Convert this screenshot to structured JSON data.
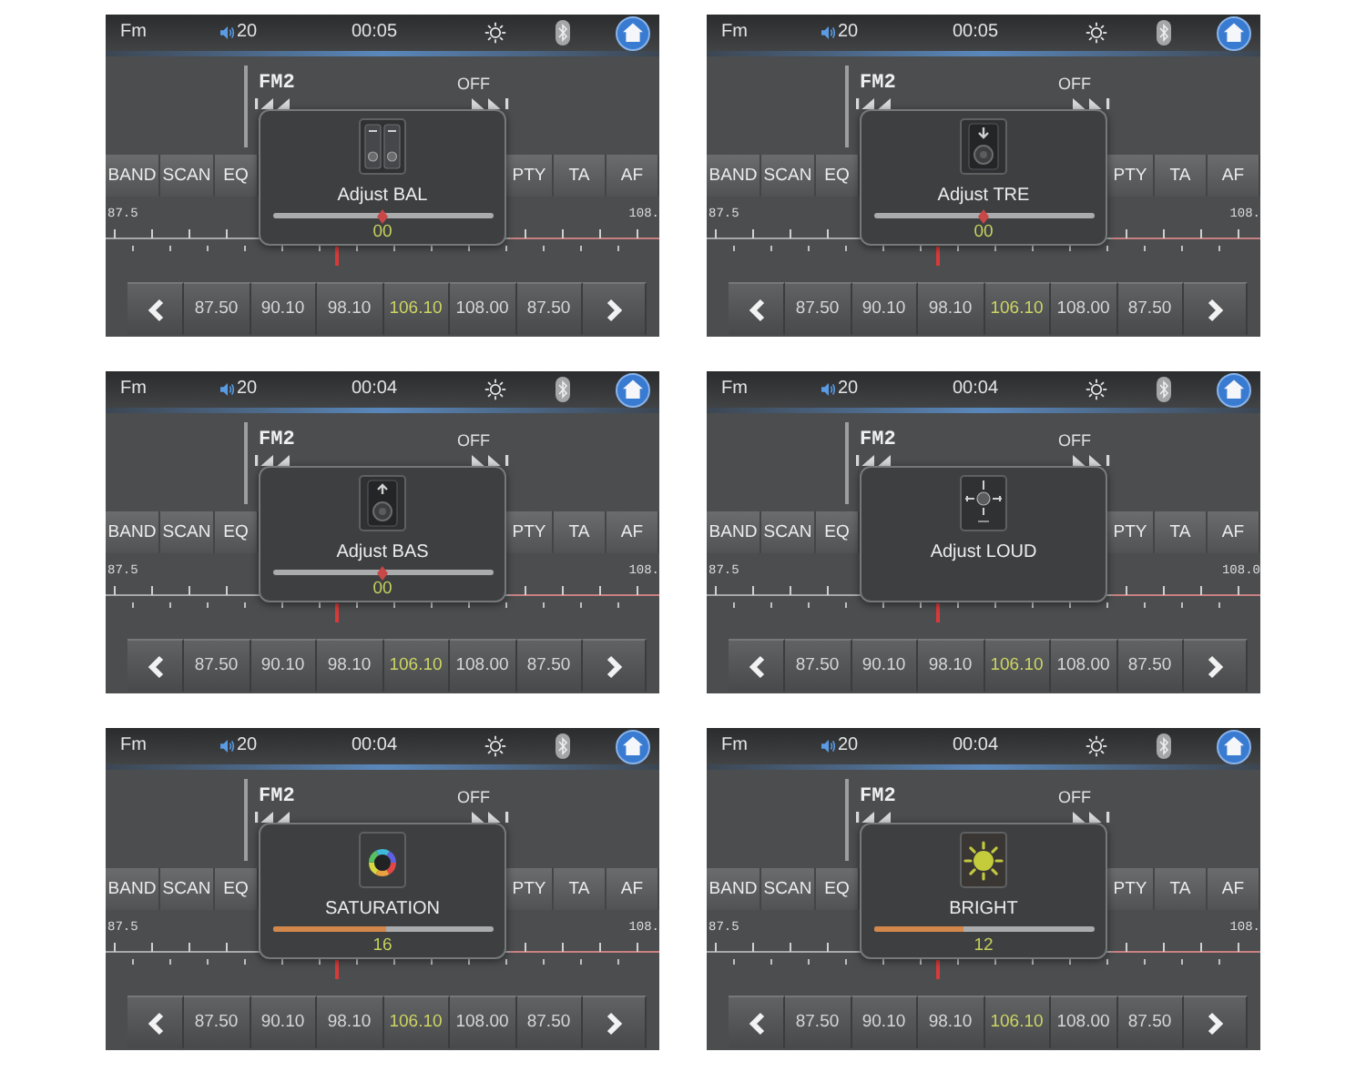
{
  "screens": [
    {
      "status_bar": {
        "source": "Fm",
        "volume": "20",
        "clock": "00:05"
      },
      "band": "FM2",
      "status": "OFF",
      "buttons_left": [
        "BAND",
        "SCAN",
        "EQ"
      ],
      "buttons_right": [
        "PTY",
        "TA",
        "AF"
      ],
      "scale": {
        "min": "87.5",
        "max": "108."
      },
      "presets": [
        {
          "label": "87.50",
          "selected": false
        },
        {
          "label": "90.10",
          "selected": false
        },
        {
          "label": "98.10",
          "selected": false
        },
        {
          "label": "106.10",
          "selected": true
        },
        {
          "label": "108.00",
          "selected": false
        },
        {
          "label": "87.50",
          "selected": false
        }
      ],
      "popup": {
        "kind": "balance",
        "label": "Adjust BAL",
        "slider": {
          "kind": "thumb",
          "level": 0.5
        },
        "value": "00"
      }
    },
    {
      "status_bar": {
        "source": "Fm",
        "volume": "20",
        "clock": "00:05"
      },
      "band": "FM2",
      "status": "OFF",
      "buttons_left": [
        "BAND",
        "SCAN",
        "EQ"
      ],
      "buttons_right": [
        "PTY",
        "TA",
        "AF"
      ],
      "scale": {
        "min": "87.5",
        "max": "108."
      },
      "presets": [
        {
          "label": "87.50",
          "selected": false
        },
        {
          "label": "90.10",
          "selected": false
        },
        {
          "label": "98.10",
          "selected": false
        },
        {
          "label": "106.10",
          "selected": true
        },
        {
          "label": "108.00",
          "selected": false
        },
        {
          "label": "87.50",
          "selected": false
        }
      ],
      "popup": {
        "kind": "treble",
        "label": "Adjust TRE",
        "slider": {
          "kind": "thumb",
          "level": 0.5
        },
        "value": "00"
      }
    },
    {
      "status_bar": {
        "source": "Fm",
        "volume": "20",
        "clock": "00:04"
      },
      "band": "FM2",
      "status": "OFF",
      "buttons_left": [
        "BAND",
        "SCAN",
        "EQ"
      ],
      "buttons_right": [
        "PTY",
        "TA",
        "AF"
      ],
      "scale": {
        "min": "87.5",
        "max": "108."
      },
      "presets": [
        {
          "label": "87.50",
          "selected": false
        },
        {
          "label": "90.10",
          "selected": false
        },
        {
          "label": "98.10",
          "selected": false
        },
        {
          "label": "106.10",
          "selected": true
        },
        {
          "label": "108.00",
          "selected": false
        },
        {
          "label": "87.50",
          "selected": false
        }
      ],
      "popup": {
        "kind": "bass",
        "label": "Adjust BAS",
        "slider": {
          "kind": "thumb",
          "level": 0.5
        },
        "value": "00"
      }
    },
    {
      "status_bar": {
        "source": "Fm",
        "volume": "20",
        "clock": "00:04"
      },
      "band": "FM2",
      "status": "OFF",
      "buttons_left": [
        "BAND",
        "SCAN",
        "EQ"
      ],
      "buttons_right": [
        "PTY",
        "TA",
        "AF"
      ],
      "scale": {
        "min": "87.5",
        "max": "108.0"
      },
      "presets": [
        {
          "label": "87.50",
          "selected": false
        },
        {
          "label": "90.10",
          "selected": false
        },
        {
          "label": "98.10",
          "selected": false
        },
        {
          "label": "106.10",
          "selected": true
        },
        {
          "label": "108.00",
          "selected": false
        },
        {
          "label": "87.50",
          "selected": false
        }
      ],
      "popup": {
        "kind": "loudness",
        "label": "Adjust LOUD"
      }
    },
    {
      "status_bar": {
        "source": "Fm",
        "volume": "20",
        "clock": "00:04"
      },
      "band": "FM2",
      "status": "OFF",
      "buttons_left": [
        "BAND",
        "SCAN",
        "EQ"
      ],
      "buttons_right": [
        "PTY",
        "TA",
        "AF"
      ],
      "scale": {
        "min": "87.5",
        "max": "108."
      },
      "presets": [
        {
          "label": "87.50",
          "selected": false
        },
        {
          "label": "90.10",
          "selected": false
        },
        {
          "label": "98.10",
          "selected": false
        },
        {
          "label": "106.10",
          "selected": true
        },
        {
          "label": "108.00",
          "selected": false
        },
        {
          "label": "87.50",
          "selected": false
        }
      ],
      "popup": {
        "kind": "saturation",
        "label": "SATURATION",
        "slider": {
          "kind": "fill",
          "level": 0.52
        },
        "value": "16"
      }
    },
    {
      "status_bar": {
        "source": "Fm",
        "volume": "20",
        "clock": "00:04"
      },
      "band": "FM2",
      "status": "OFF",
      "buttons_left": [
        "BAND",
        "SCAN",
        "EQ"
      ],
      "buttons_right": [
        "PTY",
        "TA",
        "AF"
      ],
      "scale": {
        "min": "87.5",
        "max": "108."
      },
      "presets": [
        {
          "label": "87.50",
          "selected": false
        },
        {
          "label": "90.10",
          "selected": false
        },
        {
          "label": "98.10",
          "selected": false
        },
        {
          "label": "106.10",
          "selected": true
        },
        {
          "label": "108.00",
          "selected": false
        },
        {
          "label": "87.50",
          "selected": false
        }
      ],
      "popup": {
        "kind": "brightness",
        "label": "BRIGHT",
        "slider": {
          "kind": "fill",
          "level": 0.41
        },
        "value": "12"
      }
    }
  ]
}
